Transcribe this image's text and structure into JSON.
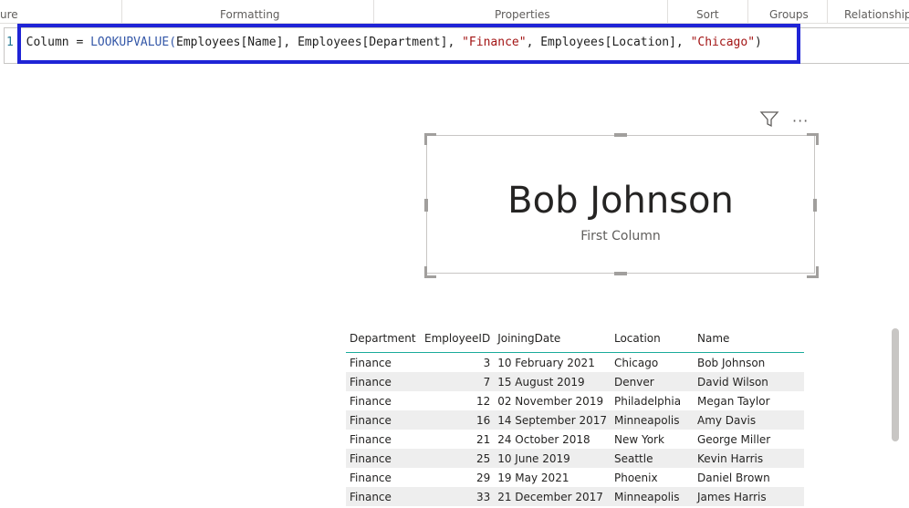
{
  "ribbon": {
    "groups": [
      "ure",
      "Formatting",
      "Properties",
      "Sort",
      "Groups",
      "Relationships"
    ]
  },
  "formula": {
    "line_number": "1",
    "parts": [
      {
        "text": "Column = ",
        "kind": "plain"
      },
      {
        "text": "LOOKUPVALUE(",
        "kind": "fn"
      },
      {
        "text": "Employees[Name], Employees[Department], ",
        "kind": "plain"
      },
      {
        "text": "\"Finance\"",
        "kind": "str"
      },
      {
        "text": ", Employees[Location], ",
        "kind": "plain"
      },
      {
        "text": "\"Chicago\"",
        "kind": "str"
      },
      {
        "text": ")",
        "kind": "plain"
      }
    ]
  },
  "card": {
    "value": "Bob Johnson",
    "caption": "First Column"
  },
  "table": {
    "headers": [
      "Department",
      "EmployeeID",
      "JoiningDate",
      "Location",
      "Name"
    ],
    "rows": [
      [
        "Finance",
        "3",
        "10 February 2021",
        "Chicago",
        "Bob Johnson"
      ],
      [
        "Finance",
        "7",
        "15 August 2019",
        "Denver",
        "David Wilson"
      ],
      [
        "Finance",
        "12",
        "02 November 2019",
        "Philadelphia",
        "Megan Taylor"
      ],
      [
        "Finance",
        "16",
        "14 September 2017",
        "Minneapolis",
        "Amy Davis"
      ],
      [
        "Finance",
        "21",
        "24 October 2018",
        "New York",
        "George Miller"
      ],
      [
        "Finance",
        "25",
        "10 June 2019",
        "Seattle",
        "Kevin Harris"
      ],
      [
        "Finance",
        "29",
        "19 May 2021",
        "Phoenix",
        "Daniel Brown"
      ],
      [
        "Finance",
        "33",
        "21 December 2017",
        "Minneapolis",
        "James Harris"
      ]
    ]
  },
  "icons": {
    "filter": "filter-icon",
    "more": "more-options-icon"
  },
  "colors": {
    "highlight": "#1f24d6",
    "table_header_rule": "#1aab9b"
  }
}
